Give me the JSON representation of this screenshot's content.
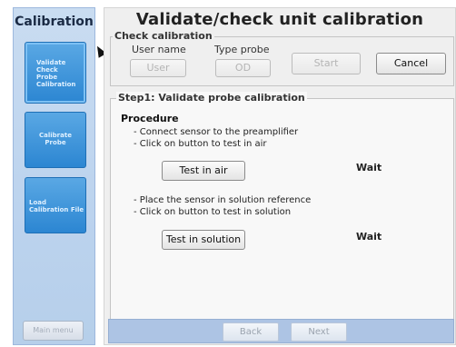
{
  "sidebar": {
    "title": "Calibration",
    "buttons": [
      {
        "lines": [
          "Validate",
          "Check",
          "Probe",
          "Calibration"
        ]
      },
      {
        "lines": [
          "Calibrate",
          "Probe"
        ]
      },
      {
        "lines": [
          "Load",
          "Calibration File"
        ]
      }
    ],
    "main_menu_label": "Main menu"
  },
  "main": {
    "title": "Validate/check unit calibration",
    "check": {
      "legend": "Check calibration",
      "user_name_label": "User name",
      "type_probe_label": "Type probe",
      "user_button": "User",
      "od_button": "OD",
      "start_button": "Start",
      "cancel_button": "Cancel"
    },
    "step": {
      "legend": "Step1: Validate probe calibration",
      "procedure_title": "Procedure",
      "instructions_air": [
        "- Connect sensor to the preamplifier",
        "- Click on button to test in air"
      ],
      "test_air_button": "Test in air",
      "air_status": "Wait",
      "instructions_solution": [
        "- Place the sensor in solution reference",
        "- Click on button to test in solution"
      ],
      "test_solution_button": "Test in solution",
      "solution_status": "Wait"
    },
    "nav": {
      "back_label": "Back",
      "next_label": "Next"
    }
  }
}
